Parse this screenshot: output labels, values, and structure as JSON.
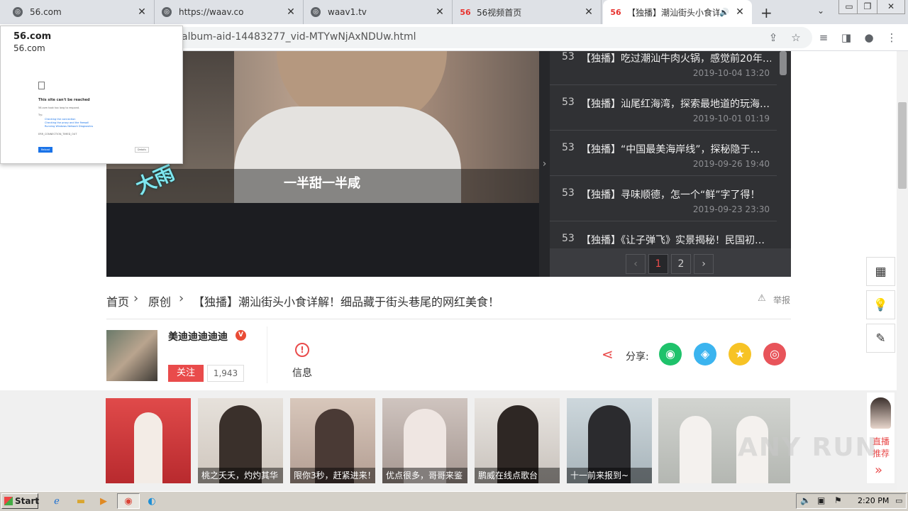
{
  "browser": {
    "tabs": [
      {
        "title": "56.com",
        "icon": "globe-icon"
      },
      {
        "title": "https://waav.co",
        "icon": "globe-icon"
      },
      {
        "title": "waav1.tv",
        "icon": "globe-icon"
      },
      {
        "title": "56视频首页",
        "icon": "56-logo"
      },
      {
        "title": "【独播】潮汕街头小食详解",
        "icon": "56-logo",
        "active": true
      }
    ],
    "tab_logo_text": "56",
    "url": "album-aid-14483277_vid-MTYwNjAxNDUw.html"
  },
  "popup": {
    "title": "56.com",
    "subtitle": "56.com",
    "error_title": "This site can't be reached",
    "error_line": "56.com took too long to respond.",
    "try_label": "Try:",
    "tips": [
      "Checking the connection",
      "Checking the proxy and the firewall",
      "Running Windows Network Diagnostics"
    ],
    "error_code": "ERR_CONNECTION_TIMED_OUT",
    "reload_label": "Reload",
    "details_label": "Details"
  },
  "video": {
    "subtitle": "一半甜一半咸",
    "stamp": "大雨"
  },
  "playlist": {
    "items": [
      {
        "num": "53",
        "title": "【独播】吃过潮汕牛肉火锅，感觉前20年…",
        "date": "2019-10-04 13:20"
      },
      {
        "num": "53",
        "title": "【独播】汕尾红海湾，探索最地道的玩海…",
        "date": "2019-10-01 01:19"
      },
      {
        "num": "53",
        "title": "【独播】“中国最美海岸线”，探秘隐于…",
        "date": "2019-09-26 19:40"
      },
      {
        "num": "53",
        "title": "【独播】寻味顺德，怎一个“鲜”字了得！",
        "date": "2019-09-23 23:30"
      },
      {
        "num": "53",
        "title": "【独播】《让子弹飞》实景揭秘！民国初…",
        "date": ""
      }
    ],
    "pager": {
      "prev": "‹",
      "pages": [
        "1",
        "2"
      ],
      "current": "1",
      "next": "›"
    }
  },
  "breadcrumb": {
    "home": "首页",
    "category": "原创",
    "title": "【独播】潮汕街头小食详解！细品藏于街头巷尾的网红美食！",
    "report": "举报"
  },
  "uploader": {
    "name": "美迪迪迪迪迪",
    "badge": "V",
    "follow_label": "关注",
    "followers": "1,943",
    "info_label": "信息"
  },
  "share": {
    "label": "分享:",
    "targets": [
      {
        "name": "wechat",
        "color": "#1fc26b"
      },
      {
        "name": "qq",
        "color": "#3bb4ef"
      },
      {
        "name": "qzone",
        "color": "#f7c325"
      },
      {
        "name": "weibo",
        "color": "#e8545a"
      }
    ]
  },
  "thumbs": [
    {
      "caption": "",
      "color": "#d8343a"
    },
    {
      "caption": "桃之夭夭，灼灼其华",
      "color": "#d9d3cc"
    },
    {
      "caption": "限你3秒，赶紧进来！",
      "color": "#c9b7ac"
    },
    {
      "caption": "优点很多，哥哥来鉴",
      "color": "#b9b0ab"
    },
    {
      "caption": "鹏威在线点歌台",
      "color": "#d6d2ce"
    },
    {
      "caption": "十一前来报到~",
      "color": "#bcc6cb"
    },
    {
      "caption": "",
      "color": "#c7c9c5"
    }
  ],
  "sidebar": {
    "live_label": "直播推荐",
    "more": "»"
  },
  "taskbar": {
    "start_label": "Start",
    "clock": "2:20 PM"
  },
  "watermark": "ANY RUN"
}
